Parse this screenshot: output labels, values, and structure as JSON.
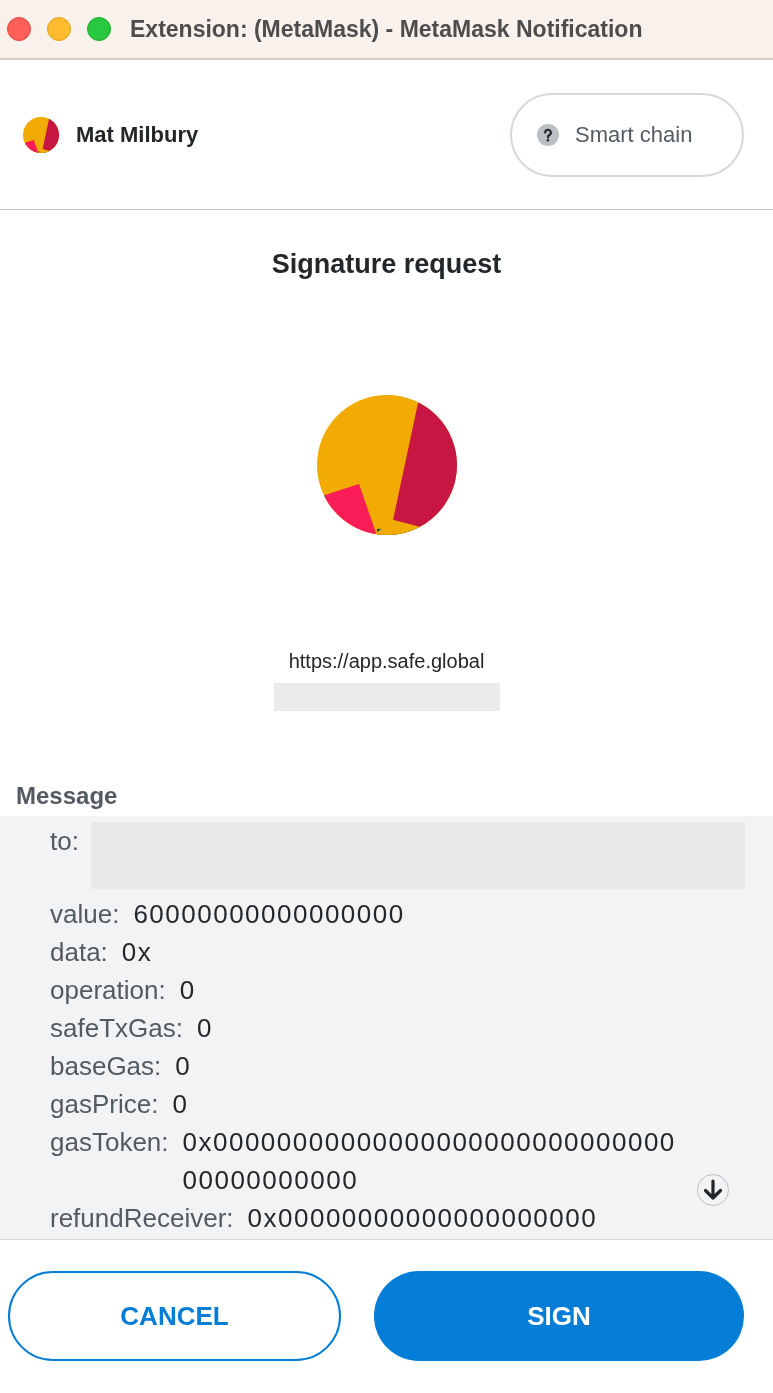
{
  "window": {
    "title": "Extension: (MetaMask) - MetaMask Notification"
  },
  "account": {
    "name": "Mat Milbury"
  },
  "network": {
    "label": "Smart chain"
  },
  "request": {
    "title": "Signature request",
    "origin": "https://app.safe.global"
  },
  "message": {
    "heading": "Message",
    "fields": [
      {
        "label": "to:",
        "kind": "redacted"
      },
      {
        "label": "value:",
        "value": "60000000000000000",
        "kind": "text"
      },
      {
        "label": "data:",
        "value": "0x",
        "kind": "text"
      },
      {
        "label": "operation:",
        "value": "0",
        "kind": "text"
      },
      {
        "label": "safeTxGas:",
        "value": "0",
        "kind": "text"
      },
      {
        "label": "baseGas:",
        "value": "0",
        "kind": "text"
      },
      {
        "label": "gasPrice:",
        "value": "0",
        "kind": "text"
      },
      {
        "label": "gasToken:",
        "value": "0x0000000000000000000000000000000000000000",
        "kind": "text"
      },
      {
        "label": "refundReceiver:",
        "value": "0x00000000000000000000",
        "kind": "text"
      }
    ]
  },
  "buttons": [
    {
      "label": "CANCEL",
      "kind": "secondary"
    },
    {
      "label": "SIGN",
      "kind": "primary"
    }
  ]
}
